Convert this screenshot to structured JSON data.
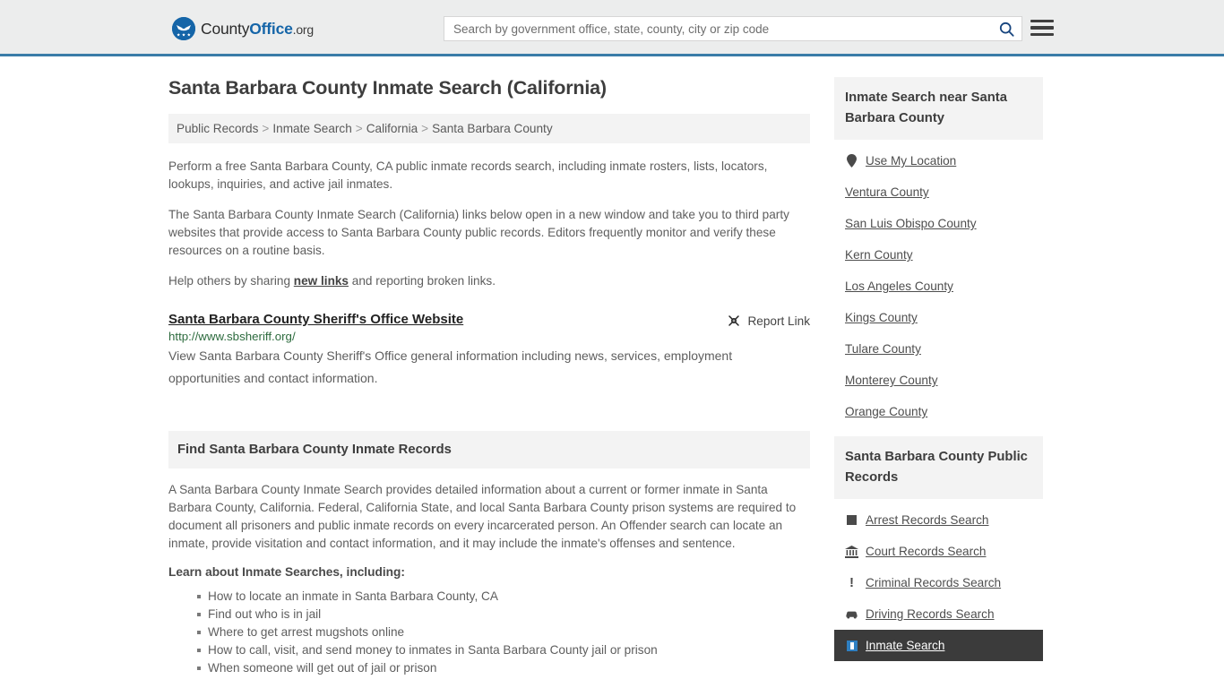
{
  "header": {
    "logo": {
      "name_part1": "County",
      "name_part2": "Office",
      "name_part3": ".org",
      "icon": "eagle-shield-icon"
    },
    "search": {
      "placeholder": "Search by government office, state, county, city or zip code",
      "value": "",
      "search_icon": "search-icon"
    },
    "menu_icon": "hamburger-menu-icon",
    "accent_color": "#1565a8",
    "border_color": "#3a7ca8"
  },
  "main": {
    "page_title": "Santa Barbara County Inmate Search (California)",
    "breadcrumb": [
      "Public Records",
      "Inmate Search",
      "California",
      "Santa Barbara County"
    ],
    "breadcrumb_separator": ">",
    "paragraphs": [
      "Perform a free Santa Barbara County, CA public inmate records search, including inmate rosters, lists, locators, lookups, inquiries, and active jail inmates.",
      "The Santa Barbara County Inmate Search (California) links below open in a new window and take you to third party websites that provide access to Santa Barbara County public records. Editors frequently monitor and verify these resources on a routine basis."
    ],
    "help_text_before": "Help others by sharing ",
    "help_link": "new links",
    "help_text_after": " and reporting broken links.",
    "result": {
      "title": "Santa Barbara County Sheriff's Office Website",
      "url": "http://www.sbsheriff.org/",
      "description": "View Santa Barbara County Sheriff's Office general information including news, services, employment opportunities and contact information.",
      "report_label": "Report Link",
      "report_icon": "broken-link-icon",
      "url_color": "#2d6b3e"
    },
    "section": {
      "heading": "Find Santa Barbara County Inmate Records",
      "paragraph": "A Santa Barbara County Inmate Search provides detailed information about a current or former inmate in Santa Barbara County, California. Federal, California State, and local Santa Barbara County prison systems are required to document all prisoners and public inmate records on every incarcerated person. An Offender search can locate an inmate, provide visitation and contact information, and it may include the inmate's offenses and sentence.",
      "list_lead": "Learn about Inmate Searches, including:",
      "bullets": [
        "How to locate an inmate in Santa Barbara County, CA",
        "Find out who is in jail",
        "Where to get arrest mugshots online",
        "How to call, visit, and send money to inmates in Santa Barbara County jail or prison",
        "When someone will get out of jail or prison"
      ]
    }
  },
  "sidebar": {
    "nearby": {
      "heading": "Inmate Search near Santa Barbara County",
      "use_my_location": {
        "label": "Use My Location",
        "icon": "map-pin-icon"
      },
      "counties": [
        "Ventura County",
        "San Luis Obispo County",
        "Kern County",
        "Los Angeles County",
        "Kings County",
        "Tulare County",
        "Monterey County",
        "Orange County"
      ]
    },
    "public_records": {
      "heading": "Santa Barbara County Public Records",
      "items": [
        {
          "label": "Arrest Records Search",
          "icon": "square-badge-icon",
          "active": false
        },
        {
          "label": "Court Records Search",
          "icon": "courthouse-icon",
          "active": false
        },
        {
          "label": "Criminal Records Search",
          "icon": "exclamation-icon",
          "active": false
        },
        {
          "label": "Driving Records Search",
          "icon": "car-icon",
          "active": false
        },
        {
          "label": "Inmate Search",
          "icon": "id-card-icon",
          "active": true
        }
      ],
      "active_bg": "#3b3b3b"
    }
  }
}
